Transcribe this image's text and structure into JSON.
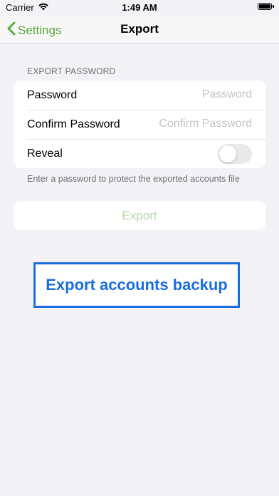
{
  "status_bar": {
    "carrier": "Carrier",
    "time": "1:49 AM"
  },
  "nav": {
    "back_label": "Settings",
    "title": "Export"
  },
  "section": {
    "header": "EXPORT PASSWORD",
    "rows": [
      {
        "label": "Password",
        "placeholder": "Password",
        "value": ""
      },
      {
        "label": "Confirm Password",
        "placeholder": "Confirm Password",
        "value": ""
      },
      {
        "label": "Reveal",
        "toggle_on": false
      }
    ],
    "footer": "Enter a password to protect the exported accounts file"
  },
  "export_button": {
    "label": "Export",
    "enabled": false
  },
  "promo": {
    "caption": "Export accounts backup"
  },
  "colors": {
    "accent": "#5aa63c",
    "accent_disabled": "#b8d9ad",
    "promo_blue": "#1a6de0",
    "background": "#f2f2f7"
  }
}
